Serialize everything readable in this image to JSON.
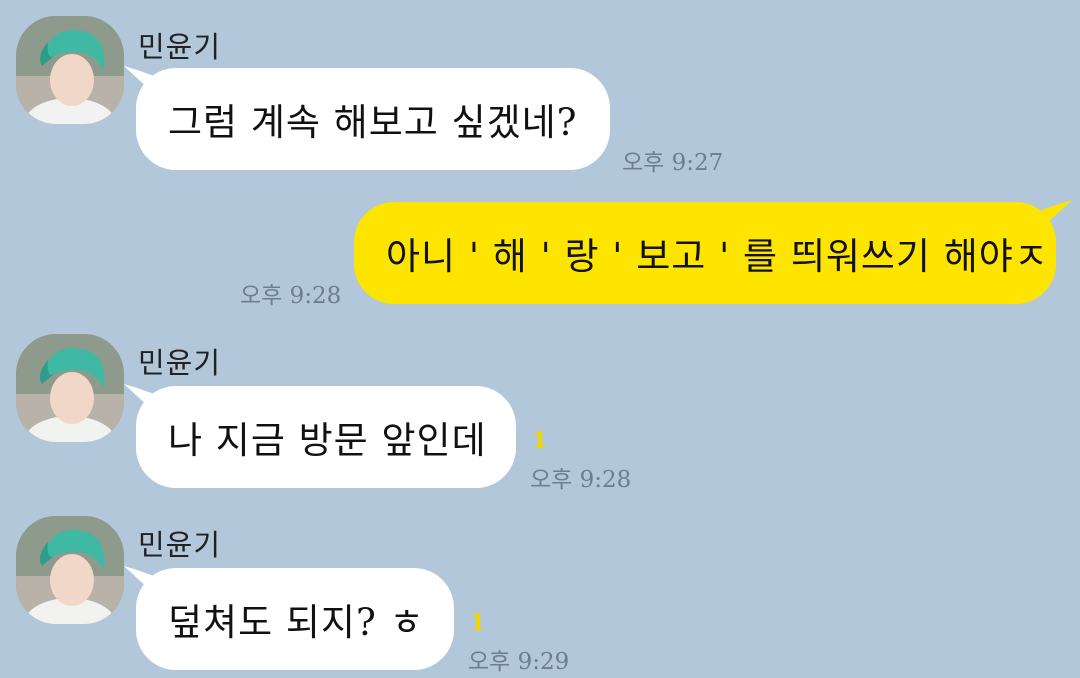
{
  "messages": [
    {
      "direction": "in",
      "sender": "민윤기",
      "text": "그럼 계속 해보고 싶겠네?",
      "time": "오후 9:27",
      "unread": ""
    },
    {
      "direction": "out",
      "text": "아니 ' 해 ' 랑 ' 보고 ' 를 띄워쓰기 해야ㅈ",
      "time": "오후 9:28"
    },
    {
      "direction": "in",
      "sender": "민윤기",
      "text": "나 지금 방문 앞인데",
      "time": "오후 9:28",
      "unread": "1"
    },
    {
      "direction": "in",
      "sender": "민윤기",
      "text": "덮쳐도 되지? ㅎ",
      "time": "오후 9:29",
      "unread": "1"
    }
  ],
  "colors": {
    "background": "#b2c7da",
    "incoming_bubble": "#ffffff",
    "outgoing_bubble": "#fee500",
    "unread": "#f2d400",
    "timestamp": "#6d7e8d"
  },
  "icons": {
    "avatar": "profile-avatar"
  }
}
